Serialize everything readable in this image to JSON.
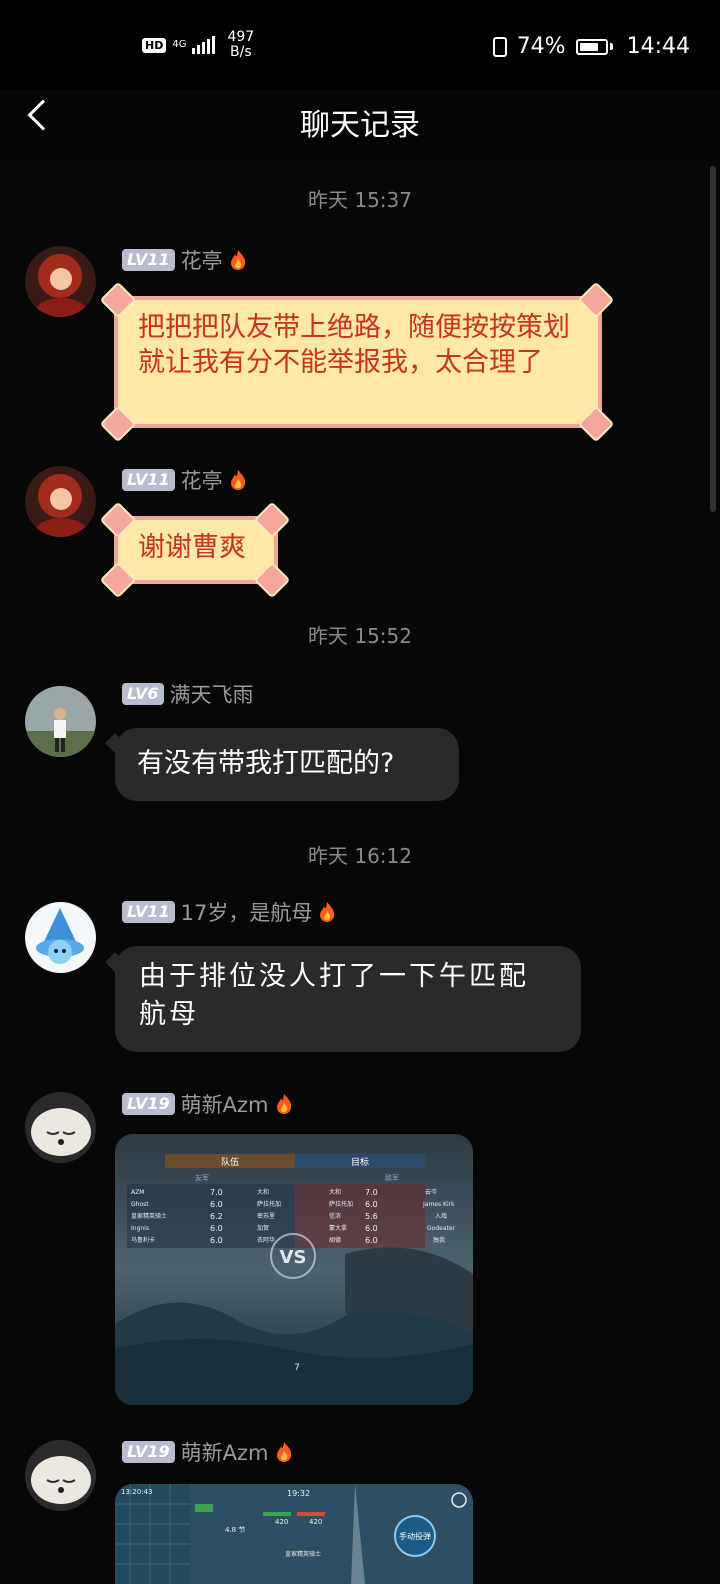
{
  "status_bar": {
    "hd": "HD",
    "net_type": "4G",
    "net_speed_value": "497",
    "net_speed_unit": "B/s",
    "battery": "74%",
    "battery_level": 0.74,
    "time": "14:44"
  },
  "nav": {
    "title": "聊天记录",
    "back_icon": "chevron-left-icon"
  },
  "timestamps": [
    "昨天 15:37",
    "昨天 15:52",
    "昨天 16:12"
  ],
  "messages": [
    {
      "level": "LV11",
      "name": "花亭",
      "text": "把把把队友带上绝路，随便按按策划就让我有分不能举报我，太合理了"
    },
    {
      "level": "LV11",
      "name": "花亭",
      "text": "谢谢曹爽"
    },
    {
      "level": "LV6",
      "name": "满天飞雨",
      "text": "有没有带我打匹配的?"
    },
    {
      "level": "LV11",
      "name": "17岁，是航母",
      "text": "由于排位没人打了一下午匹配航母"
    },
    {
      "level": "LV19",
      "name": "萌新Azm",
      "image": {
        "tabs": [
          "队伍",
          "目标"
        ],
        "left_header": "友军",
        "right_header": "敌军",
        "vs": "VS",
        "left_rows": [
          {
            "name": "AZM",
            "score": "7.0",
            "ship": "大和"
          },
          {
            "name": "Ghost",
            "score": "6.0",
            "ship": "萨拉托加"
          },
          {
            "name": "皇家精英骑士",
            "score": "6.2",
            "ship": "密苏里"
          },
          {
            "name": "Ingnis",
            "score": "6.0",
            "ship": "加贺"
          },
          {
            "name": "乌鲁利卡",
            "score": "6.0",
            "ship": "衣阿华"
          }
        ],
        "right_rows": [
          {
            "ship": "大和",
            "score": "7.0",
            "name": "云岑"
          },
          {
            "ship": "萨拉托加",
            "score": "6.0",
            "name": "James Kirk"
          },
          {
            "ship": "信浓",
            "score": "5.6",
            "name": "入戏"
          },
          {
            "ship": "蒙大拿",
            "score": "6.0",
            "name": "Godeater"
          },
          {
            "ship": "胡德",
            "score": "6.0",
            "name": "独我"
          }
        ],
        "counter": "7"
      }
    },
    {
      "level": "LV19",
      "name": "萌新Azm",
      "image": {
        "time1": "13:20:43",
        "time2": "19:32",
        "hud_values": [
          "420",
          "420"
        ],
        "button": "手动投弹",
        "speed": "4.8 节",
        "caption": "皇家精英骑士"
      }
    }
  ],
  "colors": {
    "background": "#070707",
    "scroll_bubble_bg": "#fde7a9",
    "scroll_bubble_text": "#c8341f",
    "dark_bubble_bg": "#2a2a2a",
    "level_badge": "#b7bcd0",
    "username": "#9a9a9a"
  }
}
